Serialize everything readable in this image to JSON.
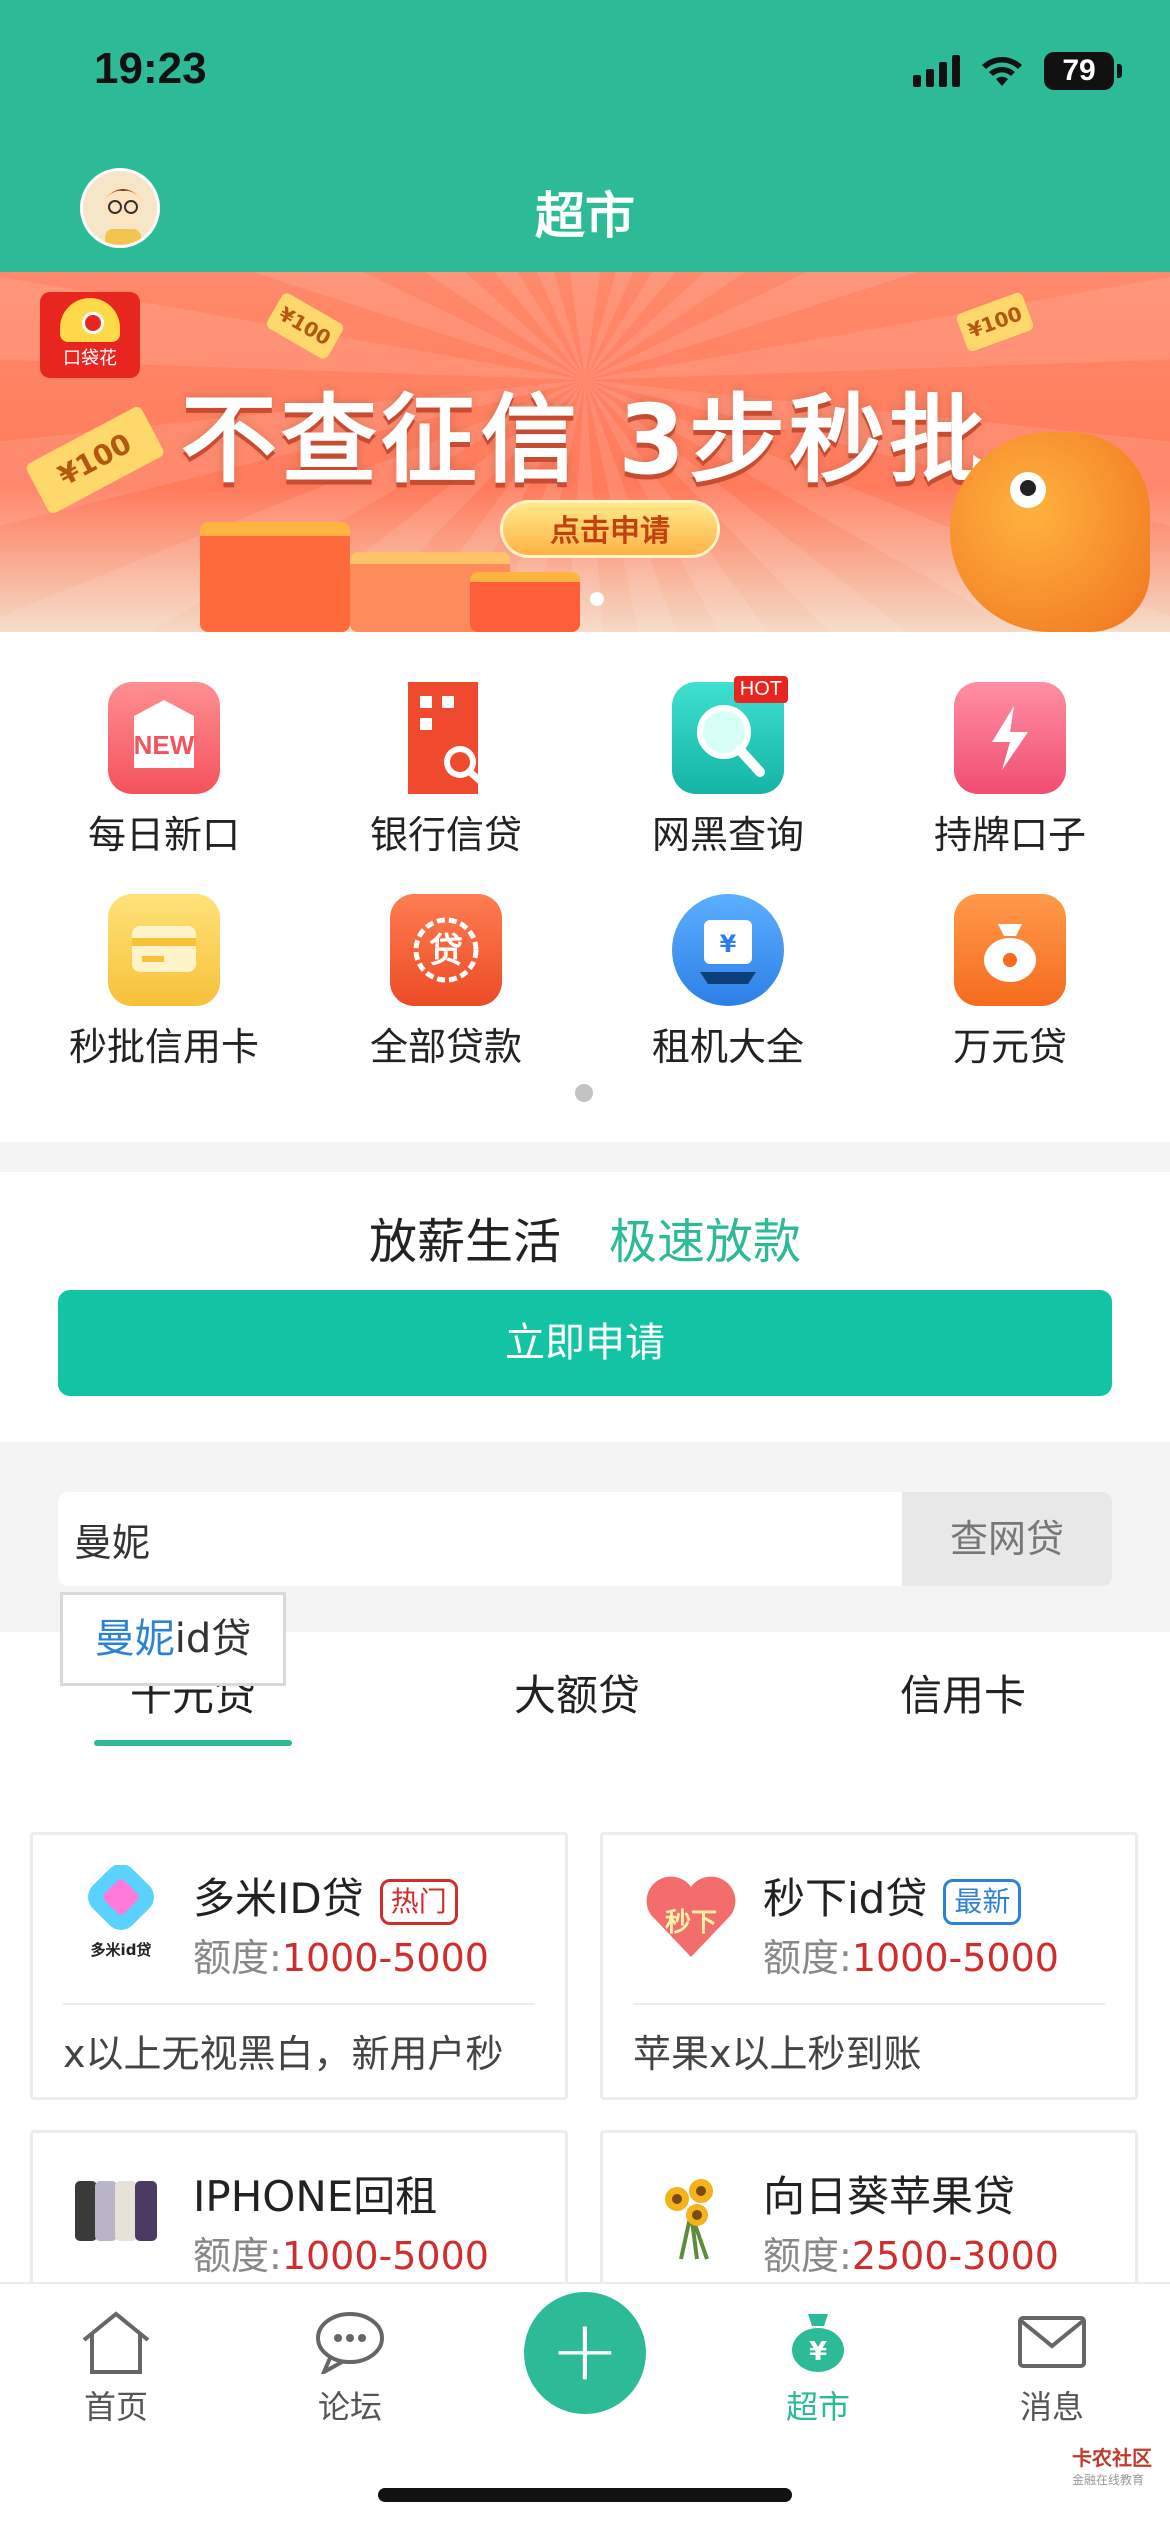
{
  "status_bar": {
    "time": "19:23",
    "battery": "79"
  },
  "header": {
    "title": "超市"
  },
  "banner": {
    "brand": "口袋花",
    "headline": "不查征信 3步秒批",
    "cta": "点击申请",
    "coupon_text": "¥100"
  },
  "categories": [
    {
      "label": "每日新口",
      "icon": "new-tag-icon",
      "icon_text": "NEW"
    },
    {
      "label": "银行信贷",
      "icon": "bank-building-icon"
    },
    {
      "label": "网黑查询",
      "icon": "magnifier-icon",
      "badge": "HOT"
    },
    {
      "label": "持牌口子",
      "icon": "lightning-icon"
    },
    {
      "label": "秒批信用卡",
      "icon": "credit-card-icon"
    },
    {
      "label": "全部贷款",
      "icon": "loan-seal-icon",
      "icon_text": "贷"
    },
    {
      "label": "租机大全",
      "icon": "rental-device-icon",
      "icon_text": "¥"
    },
    {
      "label": "万元贷",
      "icon": "money-bag-icon"
    }
  ],
  "promo": {
    "text_primary": "放薪生活",
    "text_secondary": "极速放款",
    "apply_button": "立即申请"
  },
  "search": {
    "value": "曼妮",
    "button": "查网贷",
    "suggestion_highlight": "曼妮",
    "suggestion_rest": "id贷"
  },
  "tabs": {
    "items": [
      "千元贷",
      "大额贷",
      "信用卡"
    ],
    "active_index": 0
  },
  "products": [
    {
      "name": "多米ID贷",
      "tag": "热门",
      "quota_label": "额度:",
      "quota": "1000-5000",
      "desc": "x以上无视黑白，新用户秒",
      "logo_caption": "多米id贷"
    },
    {
      "name": "秒下id贷",
      "tag": "最新",
      "quota_label": "额度:",
      "quota": "1000-5000",
      "desc": "苹果x以上秒到账",
      "logo_caption": "秒下"
    },
    {
      "name": "IPHONE回租",
      "quota_label": "额度:",
      "quota": "1000-5000"
    },
    {
      "name": "向日葵苹果贷",
      "quota_label": "额度:",
      "quota": "2500-3000"
    }
  ],
  "bottom_nav": {
    "items": [
      {
        "label": "首页",
        "icon": "home-icon"
      },
      {
        "label": "论坛",
        "icon": "chat-bubble-icon"
      },
      {
        "label": "超市",
        "icon": "money-bag-icon",
        "active": true
      },
      {
        "label": "消息",
        "icon": "envelope-icon"
      }
    ],
    "plus": "+"
  },
  "watermark": {
    "title": "卡农社区",
    "subtitle": "金融在线教育"
  },
  "colors": {
    "primary": "#2dbb97",
    "button": "#12c3a4",
    "price": "#d12d2d",
    "hot_tag": "#d12d2d",
    "new_tag": "#2e82d6"
  }
}
